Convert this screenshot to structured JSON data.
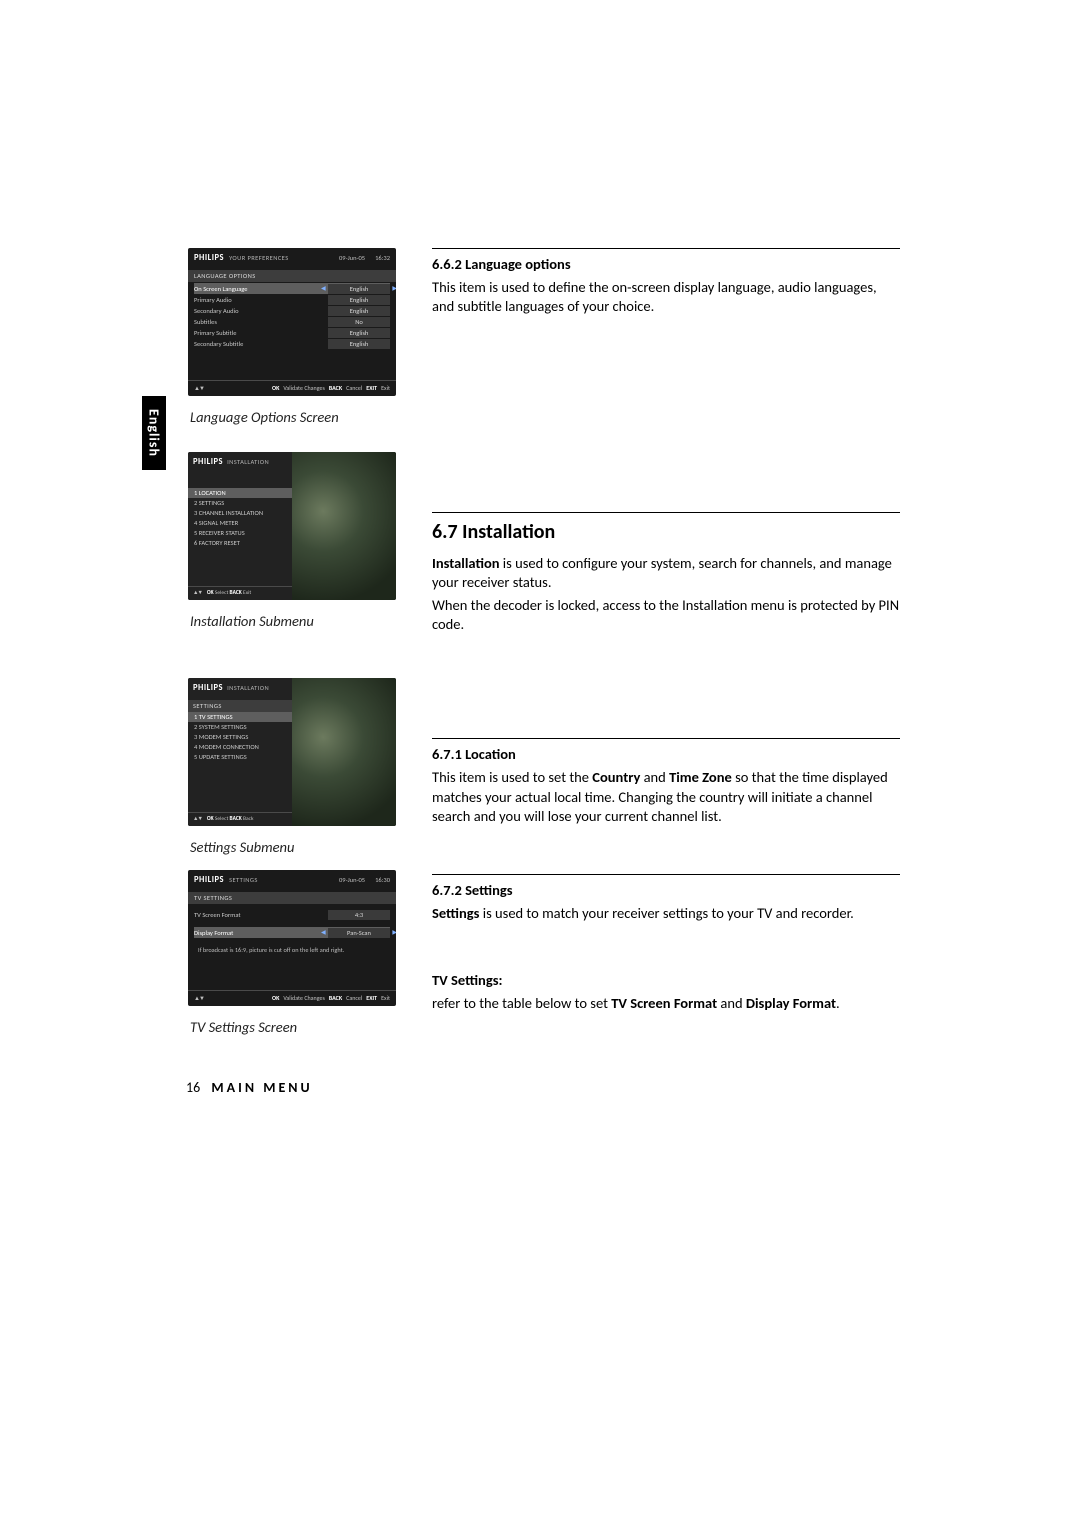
{
  "tab": "English",
  "footer": {
    "page": "16",
    "title": "MAIN MENU"
  },
  "shot1": {
    "brand": "PHILIPS",
    "crumb": "YOUR PREFERENCES",
    "date": "09-Jun-05",
    "time": "16:32",
    "section": "LANGUAGE OPTIONS",
    "rows": [
      {
        "label": "On Screen Language",
        "value": "English",
        "sel": true
      },
      {
        "label": "Primary Audio",
        "value": "English"
      },
      {
        "label": "Secondary Audio",
        "value": "English"
      },
      {
        "label": "Subtitles",
        "value": "No"
      },
      {
        "label": "Primary Subtitle",
        "value": "English"
      },
      {
        "label": "Secondary Subtitle",
        "value": "English"
      }
    ],
    "hint_ok": "OK",
    "hint_ok_t": "Validate Changes",
    "hint_bk": "BACK",
    "hint_bk_t": "Cancel",
    "hint_ex": "EXIT",
    "hint_ex_t": "Exit",
    "caption": "Language Options Screen"
  },
  "shot2": {
    "brand": "PHILIPS",
    "crumb": "INSTALLATION",
    "items": [
      "1  LOCATION",
      "2  SETTINGS",
      "3  CHANNEL INSTALLATION",
      "4  SIGNAL METER",
      "5  RECEIVER STATUS",
      "6  FACTORY RESET"
    ],
    "hint_ok": "OK",
    "hint_ok_t": "Select",
    "hint_bk": "BACK",
    "hint_bk_t": "Exit",
    "caption": "Installation Submenu"
  },
  "shot3": {
    "brand": "PHILIPS",
    "crumb": "INSTALLATION",
    "section": "SETTINGS",
    "items": [
      "1  TV SETTINGS",
      "2  SYSTEM SETTINGS",
      "3  MODEM SETTINGS",
      "4  MODEM CONNECTION",
      "5  UPDATE SETTINGS"
    ],
    "hint_ok": "OK",
    "hint_ok_t": "Select",
    "hint_bk": "BACK",
    "hint_bk_t": "Back",
    "caption": "Settings Submenu"
  },
  "shot4": {
    "brand": "PHILIPS",
    "crumb": "SETTINGS",
    "date": "09-Jun-05",
    "time": "16:30",
    "section": "TV SETTINGS",
    "rows": [
      {
        "label": "TV Screen Format",
        "value": "4:3"
      },
      {
        "label": "Display Format",
        "value": "Pan-Scan",
        "sel": true
      }
    ],
    "note": "If broadcast is 16:9, picture is cut off on the left and right.",
    "hint_ok": "OK",
    "hint_ok_t": "Validate Changes",
    "hint_bk": "BACK",
    "hint_bk_t": "Cancel",
    "hint_ex": "EXIT",
    "hint_ex_t": "Exit",
    "caption": "TV Settings Screen"
  },
  "text": {
    "s662_h": "6.6.2   Language options",
    "s662_p": "This item is used to define the on-screen display language, audio languages, and subtitle languages of your choice.",
    "s67_h": "6.7   Installation",
    "s67_p1a": "Installation",
    "s67_p1b": " is used to configure your system, search for channels, and manage your receiver status.",
    "s67_p2": "When the decoder is locked, access to the Installation menu is protected by PIN code.",
    "s671_h": "6.7.1   Location",
    "s671_p1a": "This item is used to set the ",
    "s671_p1b": "Country",
    "s671_p1c": " and ",
    "s671_p1d": "Time Zone",
    "s671_p1e": " so that the time displayed matches your actual local time. Changing the country will initiate a channel search and you will lose your current channel list.",
    "s672_h": "6.7.2   Settings",
    "s672_p1a": "Settings",
    "s672_p1b": " is used to match your receiver settings to your TV and recorder.",
    "tvset_h": "TV Settings:",
    "tvset_p1a": "refer to the table below to set ",
    "tvset_p1b": "TV Screen Format",
    "tvset_p1c": " and ",
    "tvset_p1d": "Display Format",
    "tvset_p1e": "."
  }
}
